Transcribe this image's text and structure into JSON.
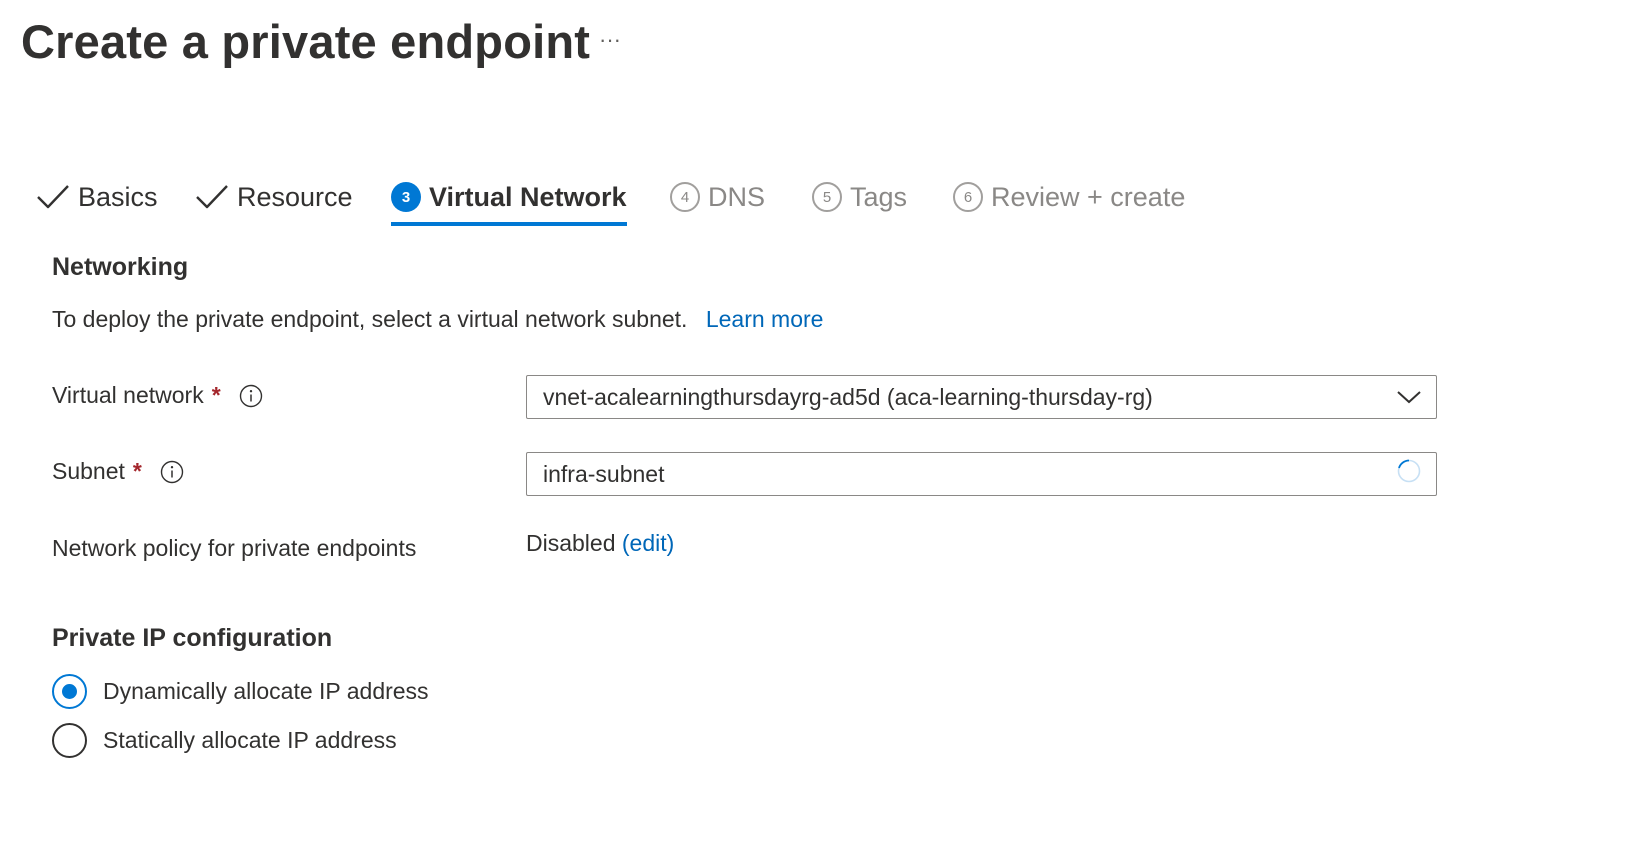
{
  "page": {
    "title": "Create a private endpoint",
    "more_label": "···"
  },
  "tabs": [
    {
      "label": "Basics",
      "state": "done"
    },
    {
      "label": "Resource",
      "state": "done"
    },
    {
      "number": "3",
      "label": "Virtual Network",
      "state": "active"
    },
    {
      "number": "4",
      "label": "DNS",
      "state": "pending"
    },
    {
      "number": "5",
      "label": "Tags",
      "state": "pending"
    },
    {
      "number": "6",
      "label": "Review + create",
      "state": "pending"
    }
  ],
  "networking": {
    "heading": "Networking",
    "description": "To deploy the private endpoint, select a virtual network subnet.",
    "learn_more": "Learn more"
  },
  "fields": {
    "virtual_network": {
      "label": "Virtual network",
      "required": "*",
      "value": "vnet-acalearningthursdayrg-ad5d (aca-learning-thursday-rg)"
    },
    "subnet": {
      "label": "Subnet",
      "required": "*",
      "value": "infra-subnet"
    },
    "network_policy": {
      "label": "Network policy for private endpoints",
      "value": "Disabled",
      "edit_label": "(edit)"
    }
  },
  "private_ip": {
    "heading": "Private IP configuration",
    "options": [
      {
        "label": "Dynamically allocate IP address",
        "selected": true
      },
      {
        "label": "Statically allocate IP address",
        "selected": false
      }
    ]
  },
  "colors": {
    "accent": "#0078d4",
    "link": "#0067b8",
    "required": "#a4262c",
    "text": "#323130",
    "muted": "#8a8886"
  },
  "icons": {
    "check": "checkmark-icon",
    "info": "info-icon",
    "dropdown": "chevron-down-icon",
    "loading": "loading-spinner-icon"
  }
}
